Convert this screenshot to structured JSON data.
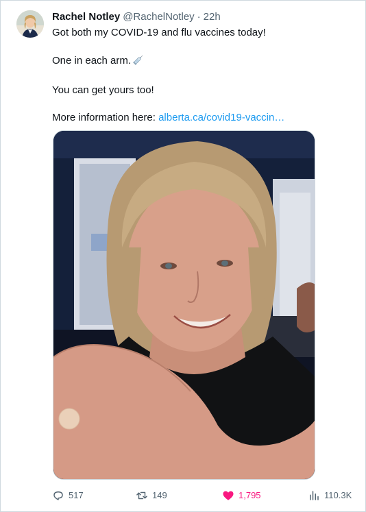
{
  "tweet": {
    "author_name": "Rachel Notley",
    "handle": "@RachelNotley",
    "separator": "·",
    "time": "22h",
    "lines": {
      "line1": "Got both my COVID-19 and flu vaccines today!",
      "line2": "One in each arm.",
      "line3": "You can get yours too!",
      "line4_prefix": "More information here: ",
      "line4_link": "alberta.ca/covid19-vaccin…"
    },
    "emoji_icon": "syringe-icon",
    "media_icon": "photo"
  },
  "actions": {
    "reply_count": "517",
    "retweet_count": "149",
    "like_count": "1,795",
    "views_count": "110.3K"
  },
  "colors": {
    "text": "#0f1419",
    "secondary": "#536471",
    "link": "#1d9bf0",
    "like": "#f91880",
    "border": "#cfd9de"
  }
}
